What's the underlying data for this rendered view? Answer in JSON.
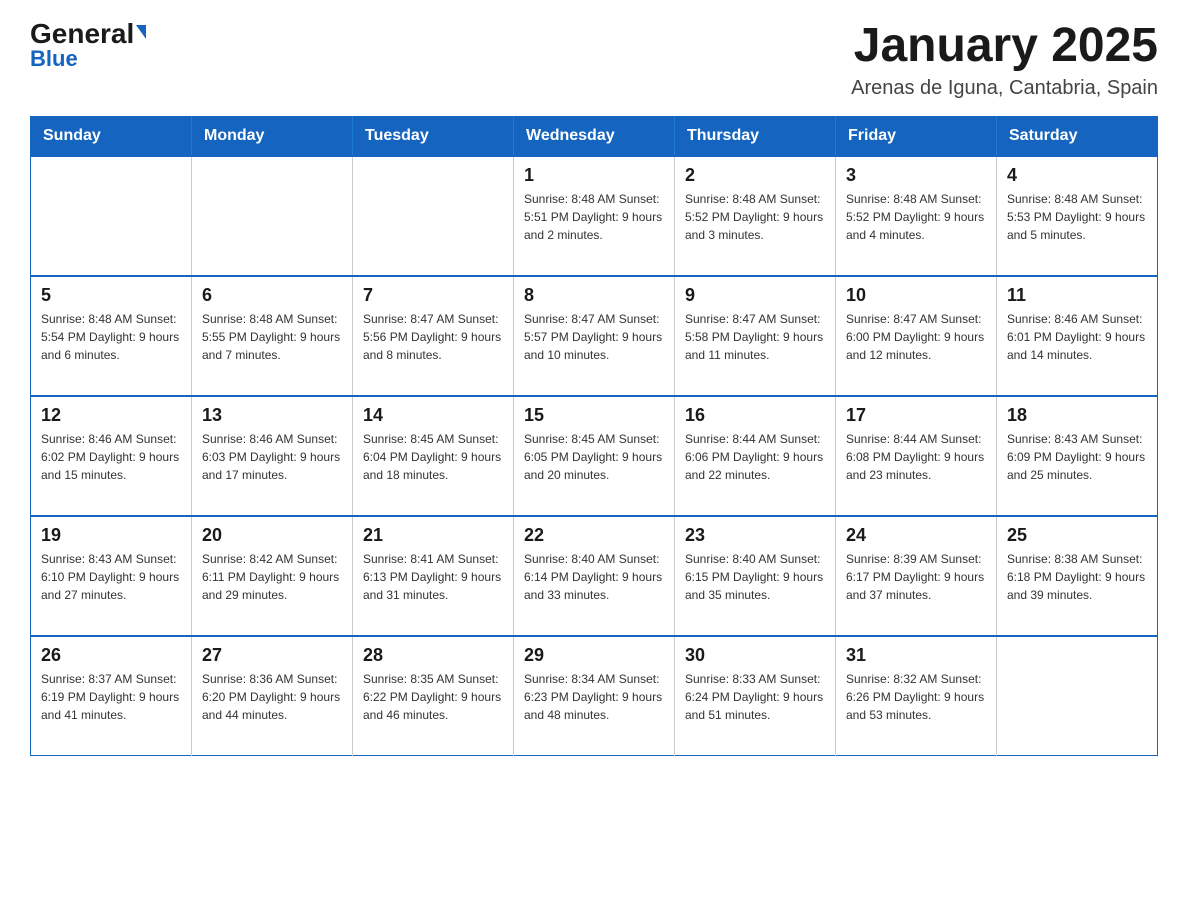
{
  "logo": {
    "general": "General",
    "blue": "Blue"
  },
  "header": {
    "title": "January 2025",
    "subtitle": "Arenas de Iguna, Cantabria, Spain"
  },
  "calendar": {
    "days_of_week": [
      "Sunday",
      "Monday",
      "Tuesday",
      "Wednesday",
      "Thursday",
      "Friday",
      "Saturday"
    ],
    "weeks": [
      [
        {
          "day": "",
          "info": ""
        },
        {
          "day": "",
          "info": ""
        },
        {
          "day": "",
          "info": ""
        },
        {
          "day": "1",
          "info": "Sunrise: 8:48 AM\nSunset: 5:51 PM\nDaylight: 9 hours and 2 minutes."
        },
        {
          "day": "2",
          "info": "Sunrise: 8:48 AM\nSunset: 5:52 PM\nDaylight: 9 hours and 3 minutes."
        },
        {
          "day": "3",
          "info": "Sunrise: 8:48 AM\nSunset: 5:52 PM\nDaylight: 9 hours and 4 minutes."
        },
        {
          "day": "4",
          "info": "Sunrise: 8:48 AM\nSunset: 5:53 PM\nDaylight: 9 hours and 5 minutes."
        }
      ],
      [
        {
          "day": "5",
          "info": "Sunrise: 8:48 AM\nSunset: 5:54 PM\nDaylight: 9 hours and 6 minutes."
        },
        {
          "day": "6",
          "info": "Sunrise: 8:48 AM\nSunset: 5:55 PM\nDaylight: 9 hours and 7 minutes."
        },
        {
          "day": "7",
          "info": "Sunrise: 8:47 AM\nSunset: 5:56 PM\nDaylight: 9 hours and 8 minutes."
        },
        {
          "day": "8",
          "info": "Sunrise: 8:47 AM\nSunset: 5:57 PM\nDaylight: 9 hours and 10 minutes."
        },
        {
          "day": "9",
          "info": "Sunrise: 8:47 AM\nSunset: 5:58 PM\nDaylight: 9 hours and 11 minutes."
        },
        {
          "day": "10",
          "info": "Sunrise: 8:47 AM\nSunset: 6:00 PM\nDaylight: 9 hours and 12 minutes."
        },
        {
          "day": "11",
          "info": "Sunrise: 8:46 AM\nSunset: 6:01 PM\nDaylight: 9 hours and 14 minutes."
        }
      ],
      [
        {
          "day": "12",
          "info": "Sunrise: 8:46 AM\nSunset: 6:02 PM\nDaylight: 9 hours and 15 minutes."
        },
        {
          "day": "13",
          "info": "Sunrise: 8:46 AM\nSunset: 6:03 PM\nDaylight: 9 hours and 17 minutes."
        },
        {
          "day": "14",
          "info": "Sunrise: 8:45 AM\nSunset: 6:04 PM\nDaylight: 9 hours and 18 minutes."
        },
        {
          "day": "15",
          "info": "Sunrise: 8:45 AM\nSunset: 6:05 PM\nDaylight: 9 hours and 20 minutes."
        },
        {
          "day": "16",
          "info": "Sunrise: 8:44 AM\nSunset: 6:06 PM\nDaylight: 9 hours and 22 minutes."
        },
        {
          "day": "17",
          "info": "Sunrise: 8:44 AM\nSunset: 6:08 PM\nDaylight: 9 hours and 23 minutes."
        },
        {
          "day": "18",
          "info": "Sunrise: 8:43 AM\nSunset: 6:09 PM\nDaylight: 9 hours and 25 minutes."
        }
      ],
      [
        {
          "day": "19",
          "info": "Sunrise: 8:43 AM\nSunset: 6:10 PM\nDaylight: 9 hours and 27 minutes."
        },
        {
          "day": "20",
          "info": "Sunrise: 8:42 AM\nSunset: 6:11 PM\nDaylight: 9 hours and 29 minutes."
        },
        {
          "day": "21",
          "info": "Sunrise: 8:41 AM\nSunset: 6:13 PM\nDaylight: 9 hours and 31 minutes."
        },
        {
          "day": "22",
          "info": "Sunrise: 8:40 AM\nSunset: 6:14 PM\nDaylight: 9 hours and 33 minutes."
        },
        {
          "day": "23",
          "info": "Sunrise: 8:40 AM\nSunset: 6:15 PM\nDaylight: 9 hours and 35 minutes."
        },
        {
          "day": "24",
          "info": "Sunrise: 8:39 AM\nSunset: 6:17 PM\nDaylight: 9 hours and 37 minutes."
        },
        {
          "day": "25",
          "info": "Sunrise: 8:38 AM\nSunset: 6:18 PM\nDaylight: 9 hours and 39 minutes."
        }
      ],
      [
        {
          "day": "26",
          "info": "Sunrise: 8:37 AM\nSunset: 6:19 PM\nDaylight: 9 hours and 41 minutes."
        },
        {
          "day": "27",
          "info": "Sunrise: 8:36 AM\nSunset: 6:20 PM\nDaylight: 9 hours and 44 minutes."
        },
        {
          "day": "28",
          "info": "Sunrise: 8:35 AM\nSunset: 6:22 PM\nDaylight: 9 hours and 46 minutes."
        },
        {
          "day": "29",
          "info": "Sunrise: 8:34 AM\nSunset: 6:23 PM\nDaylight: 9 hours and 48 minutes."
        },
        {
          "day": "30",
          "info": "Sunrise: 8:33 AM\nSunset: 6:24 PM\nDaylight: 9 hours and 51 minutes."
        },
        {
          "day": "31",
          "info": "Sunrise: 8:32 AM\nSunset: 6:26 PM\nDaylight: 9 hours and 53 minutes."
        },
        {
          "day": "",
          "info": ""
        }
      ]
    ]
  }
}
